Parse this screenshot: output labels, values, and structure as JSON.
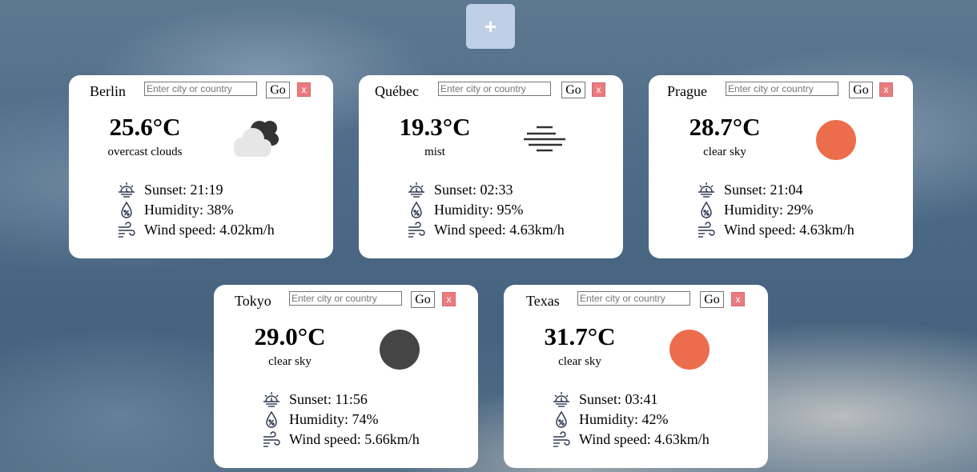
{
  "add_button": {
    "label": "+"
  },
  "search": {
    "placeholder": "Enter city or country",
    "go_label": "Go",
    "close_label": "x"
  },
  "detail_labels": {
    "sunset": "Sunset:",
    "humidity": "Humidity:",
    "wind": "Wind speed:"
  },
  "colors": {
    "sun": "#ec6d4c",
    "moon": "#454545",
    "cloud": "#333333",
    "accent": "#bfd0e6",
    "close": "#ea7b7f"
  },
  "cards": [
    {
      "city": "Berlin",
      "temp": "25.6°C",
      "desc": "overcast clouds",
      "icon": "overcast-cloud-icon",
      "sunset": "21:19",
      "humidity": "38%",
      "wind": "4.02km/h"
    },
    {
      "city": "Québec",
      "temp": "19.3°C",
      "desc": "mist",
      "icon": "mist-icon",
      "sunset": "02:33",
      "humidity": "95%",
      "wind": "4.63km/h"
    },
    {
      "city": "Prague",
      "temp": "28.7°C",
      "desc": "clear sky",
      "icon": "sun-icon",
      "sunset": "21:04",
      "humidity": "29%",
      "wind": "4.63km/h"
    },
    {
      "city": "Tokyo",
      "temp": "29.0°C",
      "desc": "clear sky",
      "icon": "moon-icon",
      "sunset": "11:56",
      "humidity": "74%",
      "wind": "5.66km/h"
    },
    {
      "city": "Texas",
      "temp": "31.7°C",
      "desc": "clear sky",
      "icon": "sun-icon",
      "sunset": "03:41",
      "humidity": "42%",
      "wind": "4.63km/h"
    }
  ]
}
